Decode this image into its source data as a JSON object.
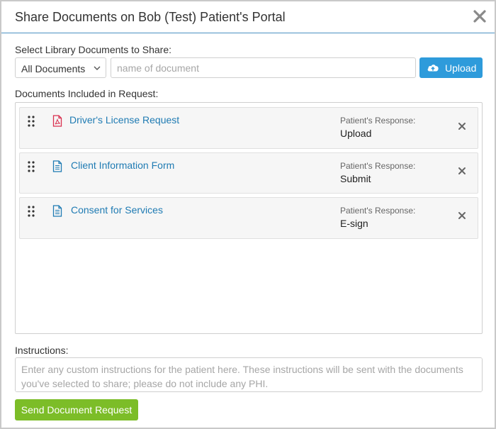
{
  "modal": {
    "title": "Share Documents on Bob (Test) Patient's Portal",
    "close_icon": "close-icon"
  },
  "library": {
    "label": "Select Library Documents to Share:",
    "filter_selected": "All Documents",
    "search_placeholder": "name of document",
    "upload_label": "Upload",
    "upload_icon": "cloud-upload-icon"
  },
  "included": {
    "label": "Documents Included in Request:",
    "response_label": "Patient's Response:",
    "documents": [
      {
        "name": "Driver's License Request",
        "icon": "pdf-icon",
        "response": "Upload"
      },
      {
        "name": "Client Information Form",
        "icon": "document-icon",
        "response": "Submit"
      },
      {
        "name": "Consent for Services",
        "icon": "document-icon",
        "response": "E-sign"
      }
    ]
  },
  "instructions": {
    "label": "Instructions:",
    "placeholder": "Enter any custom instructions for the patient here. These instructions will be sent with the documents you've selected to share; please do not include any PHI."
  },
  "footer": {
    "send_label": "Send Document Request"
  },
  "colors": {
    "accent_blue": "#2e9bdb",
    "link_blue": "#1f7bb3",
    "send_green": "#7cbd28",
    "pdf_red": "#d9304f"
  }
}
